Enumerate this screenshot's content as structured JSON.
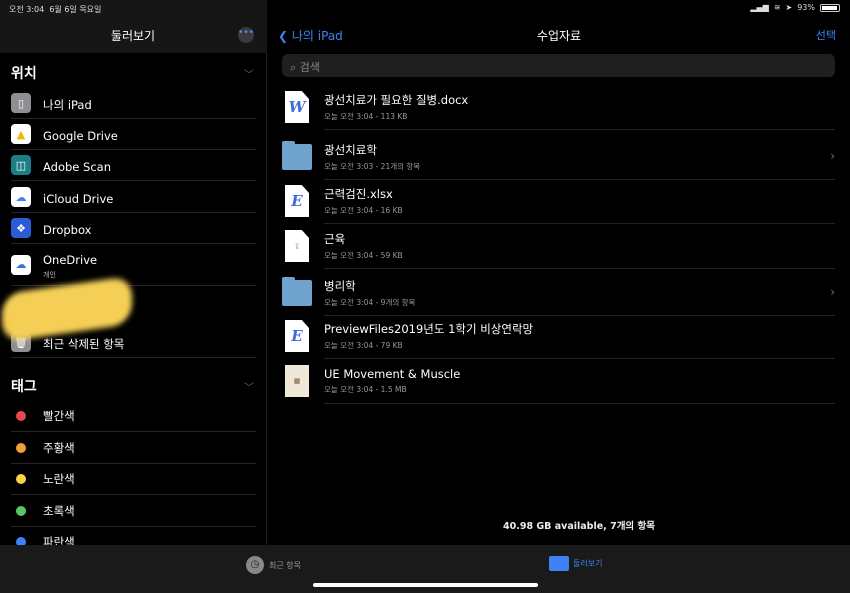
{
  "status": {
    "time": "오전 3:04",
    "date": "6월 6일 목요일",
    "battery": "93%",
    "battery_level": 0.93
  },
  "sidebar": {
    "title": "둘러보기",
    "more_icon": "ellipsis-icon",
    "locations_title": "위치",
    "locations": [
      {
        "label": "나의 iPad",
        "icon": "ipad-icon",
        "color": "#8e8e93"
      },
      {
        "label": "Google Drive",
        "icon": "google-drive-icon",
        "color": "#ffffff"
      },
      {
        "label": "Adobe Scan",
        "icon": "adobe-scan-icon",
        "color": "#1b7f86"
      },
      {
        "label": "iCloud Drive",
        "icon": "icloud-icon",
        "color": "#ffffff"
      },
      {
        "label": "Dropbox",
        "icon": "dropbox-icon",
        "color": "#2c5bd6"
      },
      {
        "label": "OneDrive",
        "sub": "개인",
        "icon": "onedrive-icon",
        "color": "#ffffff"
      },
      {
        "label": "최근 삭제된 항목",
        "icon": "trash-icon",
        "color": "#8e8e93"
      }
    ],
    "tags_title": "태그",
    "tags": [
      {
        "label": "빨간색",
        "color": "#e5484d"
      },
      {
        "label": "주황색",
        "color": "#f2a03d"
      },
      {
        "label": "노란색",
        "color": "#f5d547"
      },
      {
        "label": "초록색",
        "color": "#5ac466"
      },
      {
        "label": "파란색",
        "color": "#3d82f6"
      }
    ]
  },
  "main": {
    "back": "나의 iPad",
    "title": "수업자료",
    "select": "선택",
    "search_placeholder": "검색",
    "files": [
      {
        "name": "광선치료가 필요한 질병.docx",
        "meta": "오늘 오전 3:04 - 113 KB",
        "type": "word",
        "glyph": "W"
      },
      {
        "name": "광선치료학",
        "meta": "오늘 오전 3:03 - 21개의 항목",
        "type": "folder"
      },
      {
        "name": "근력검진.xlsx",
        "meta": "오늘 오전 3:04 - 16 KB",
        "type": "doc",
        "glyph": "E"
      },
      {
        "name": "근육",
        "meta": "오늘 오전 3:04 - 59 KB",
        "type": "doc",
        "glyph": ""
      },
      {
        "name": "병리학",
        "meta": "오늘 오전 3:04 - 9개의 항목",
        "type": "folder"
      },
      {
        "name": "PreviewFiles2019년도 1학기 비상연락망",
        "meta": "오늘 오전 3:04 - 79 KB",
        "type": "doc",
        "glyph": "E"
      },
      {
        "name": "UE Movement & Muscle",
        "meta": "오늘 오전 3:04 - 1.5 MB",
        "type": "thumb"
      }
    ],
    "footer": "40.98 GB available, 7개의 항목"
  },
  "tabbar": {
    "recent": "최근 항목",
    "browse": "둘러보기",
    "accent": "#3d82f6"
  }
}
